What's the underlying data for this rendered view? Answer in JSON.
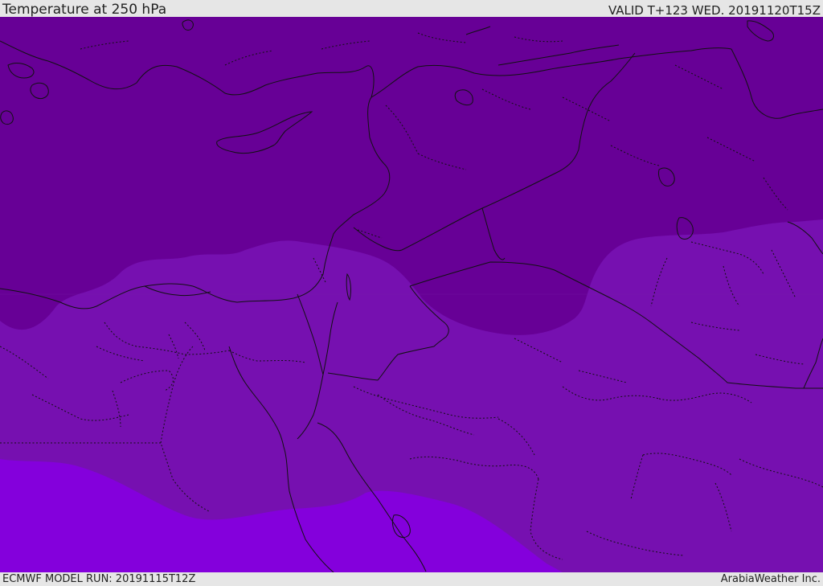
{
  "header": {
    "title": "Temperature at 250 hPa",
    "valid": "VALID T+123 WED. 20191120T15Z"
  },
  "footer": {
    "model_run": "ECMWF MODEL RUN: 20191115T12Z",
    "credit": "ArabiaWeather Inc."
  },
  "map": {
    "field": "temperature_250hPa",
    "bands": [
      {
        "name": "coldest-band",
        "color": "#670096"
      },
      {
        "name": "middle-band",
        "color": "#7610b0"
      },
      {
        "name": "warmest-band",
        "color": "#8400dc"
      }
    ],
    "coastline_color": "#111111",
    "border_style": "dotted"
  }
}
